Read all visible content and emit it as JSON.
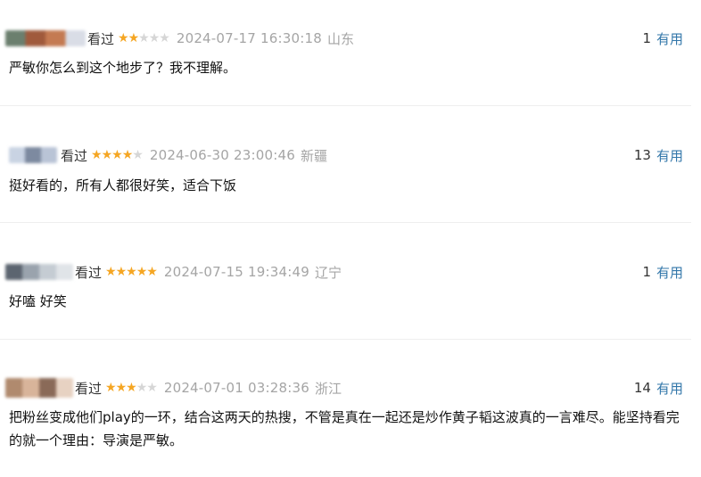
{
  "comments": [
    {
      "status": "看过",
      "rating": 2,
      "time": "2024-07-17 16:30:18",
      "region": "山东",
      "votes": "1",
      "useful_label": "有用",
      "content": "严敏你怎么到这个地步了？我不理解。",
      "avatar_colors": [
        "#6b7f6e",
        "#a05a3c",
        "#c47a52",
        "#d9dde6"
      ]
    },
    {
      "status": "看过",
      "rating": 4,
      "time": "2024-06-30 23:00:46",
      "region": "新疆",
      "votes": "13",
      "useful_label": "有用",
      "content": "挺好看的，所有人都很好笑，适合下饭",
      "avatar_colors": [
        "#c9d3e3",
        "#7d8aa0",
        "#b9c4d6"
      ]
    },
    {
      "status": "看过",
      "rating": 5,
      "time": "2024-07-15 19:34:49",
      "region": "辽宁",
      "votes": "1",
      "useful_label": "有用",
      "content": "好嗑 好笑",
      "avatar_colors": [
        "#5c6570",
        "#9aa3ad",
        "#c5ccd3",
        "#e0e4e8"
      ]
    },
    {
      "status": "看过",
      "rating": 3,
      "time": "2024-07-01 03:28:36",
      "region": "浙江",
      "votes": "14",
      "useful_label": "有用",
      "content": "把粉丝变成他们play的一环，结合这两天的热搜，不管是真在一起还是炒作黄子韬这波真的一言难尽。能坚持看完的就一个理由：导演是严敏。",
      "avatar_colors": [
        "#b08a6e",
        "#d8b49a",
        "#8a6a58",
        "#e7d2c2"
      ]
    }
  ],
  "max_stars": 5
}
